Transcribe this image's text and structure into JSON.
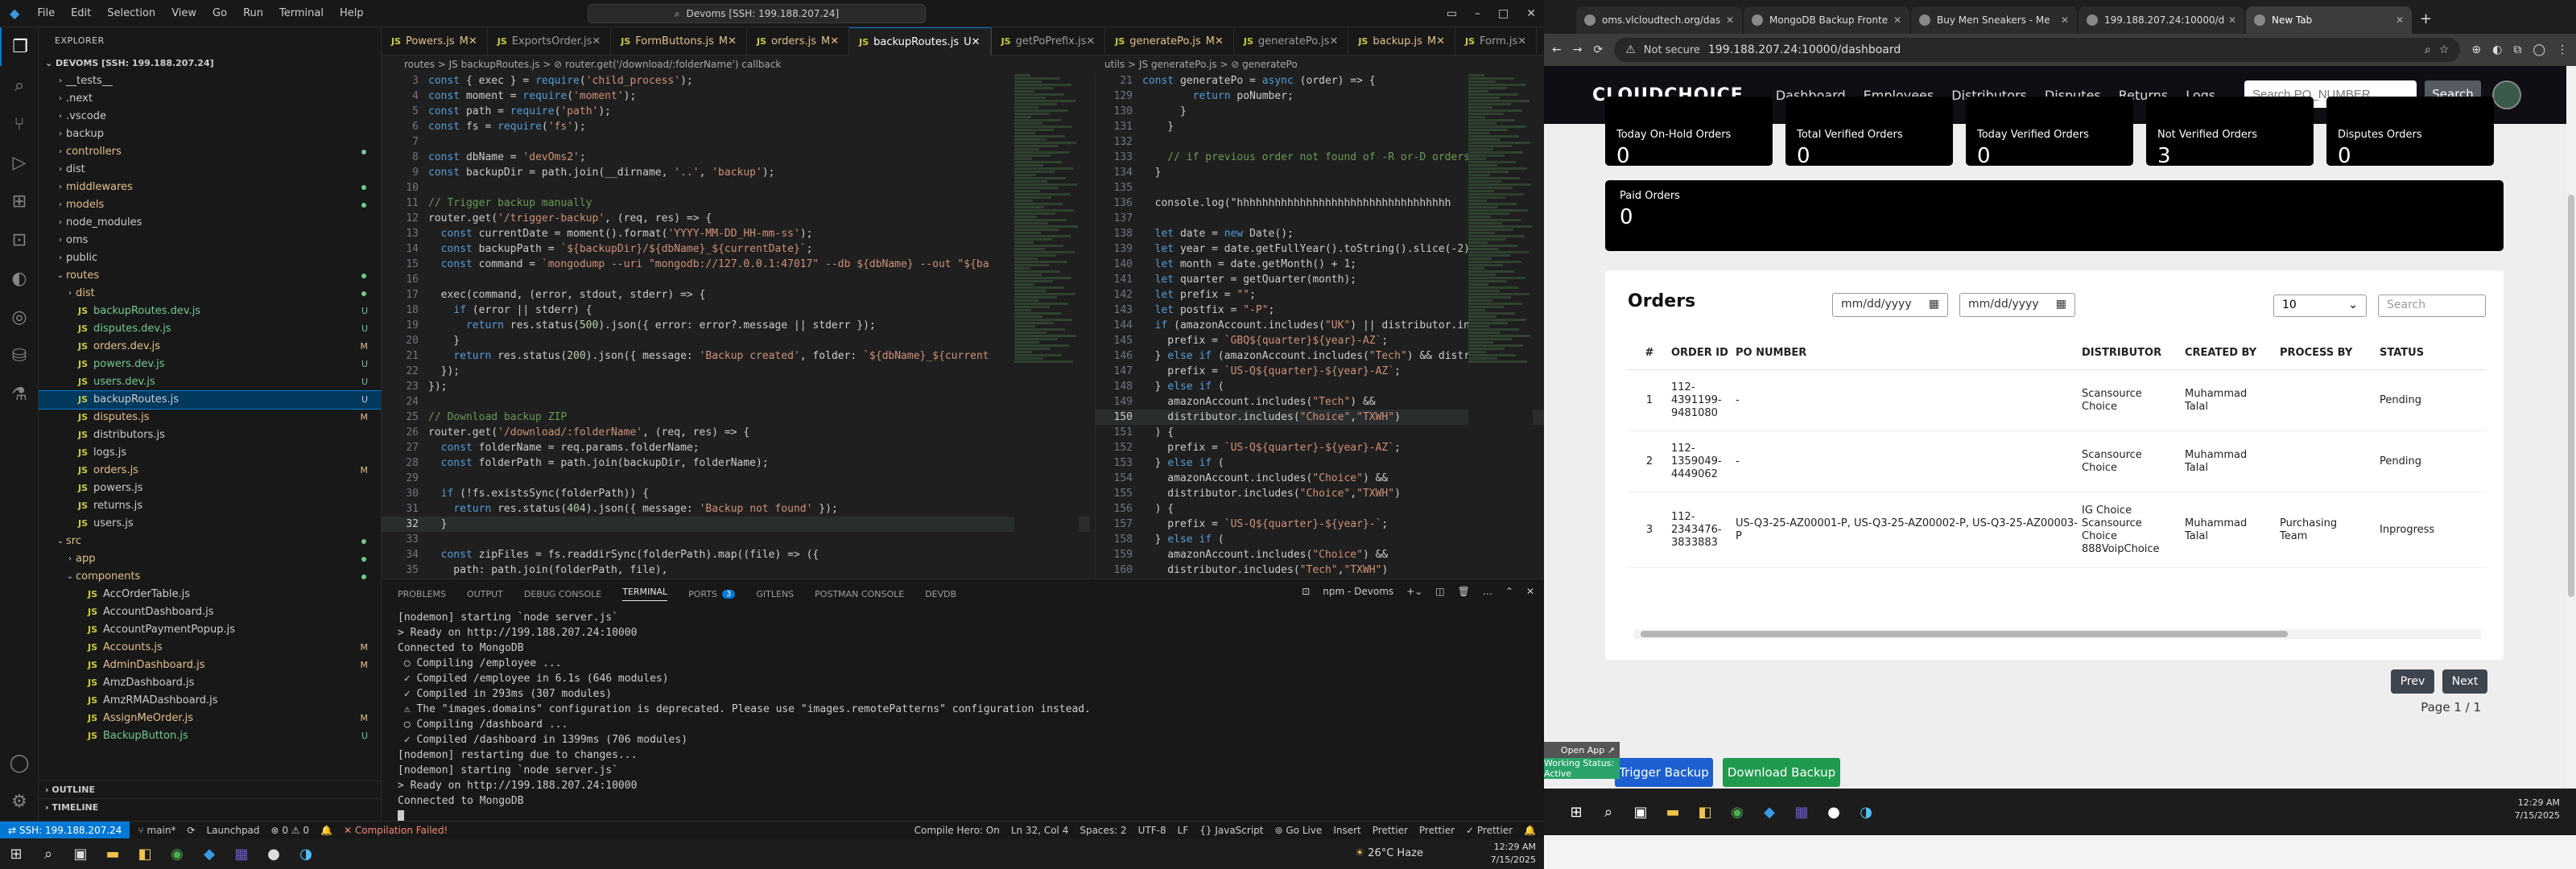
{
  "vscode": {
    "menu": [
      "File",
      "Edit",
      "Selection",
      "View",
      "Go",
      "Run",
      "Terminal",
      "Help"
    ],
    "command_center": "Devoms [SSH: 199.188.207.24]",
    "explorer_title": "EXPLORER",
    "root": "DEVOMS [SSH: 199.188.207.24]",
    "tree": [
      {
        "label": "__tests__",
        "kind": "folder",
        "indent": 1,
        "state": ""
      },
      {
        "label": ".next",
        "kind": "folder",
        "indent": 1,
        "state": ""
      },
      {
        "label": ".vscode",
        "kind": "folder",
        "indent": 1,
        "state": ""
      },
      {
        "label": "backup",
        "kind": "folder",
        "indent": 1,
        "state": ""
      },
      {
        "label": "controllers",
        "kind": "folder",
        "indent": 1,
        "state": "mod"
      },
      {
        "label": "dist",
        "kind": "folder",
        "indent": 1,
        "state": ""
      },
      {
        "label": "middlewares",
        "kind": "folder",
        "indent": 1,
        "state": "mod"
      },
      {
        "label": "models",
        "kind": "folder",
        "indent": 1,
        "state": "mod"
      },
      {
        "label": "node_modules",
        "kind": "folder",
        "indent": 1,
        "state": ""
      },
      {
        "label": "oms",
        "kind": "folder",
        "indent": 1,
        "state": ""
      },
      {
        "label": "public",
        "kind": "folder",
        "indent": 1,
        "state": ""
      },
      {
        "label": "routes",
        "kind": "folder-open",
        "indent": 1,
        "state": "mod"
      },
      {
        "label": "dist",
        "kind": "folder",
        "indent": 2,
        "state": "mod"
      },
      {
        "label": "backupRoutes.dev.js",
        "kind": "js",
        "indent": 2,
        "state": "unt",
        "badge": "U"
      },
      {
        "label": "disputes.dev.js",
        "kind": "js",
        "indent": 2,
        "state": "unt",
        "badge": "U"
      },
      {
        "label": "orders.dev.js",
        "kind": "js",
        "indent": 2,
        "state": "mod",
        "badge": "M"
      },
      {
        "label": "powers.dev.js",
        "kind": "js",
        "indent": 2,
        "state": "unt",
        "badge": "U"
      },
      {
        "label": "users.dev.js",
        "kind": "js",
        "indent": 2,
        "state": "unt",
        "badge": "U"
      },
      {
        "label": "backupRoutes.js",
        "kind": "js",
        "indent": 2,
        "state": "sel",
        "badge": "U"
      },
      {
        "label": "disputes.js",
        "kind": "js",
        "indent": 2,
        "state": "mod",
        "badge": "M"
      },
      {
        "label": "distributors.js",
        "kind": "js",
        "indent": 2,
        "state": "",
        "badge": ""
      },
      {
        "label": "logs.js",
        "kind": "js",
        "indent": 2,
        "state": "",
        "badge": ""
      },
      {
        "label": "orders.js",
        "kind": "js",
        "indent": 2,
        "state": "mod",
        "badge": "M"
      },
      {
        "label": "powers.js",
        "kind": "js",
        "indent": 2,
        "state": "",
        "badge": ""
      },
      {
        "label": "returns.js",
        "kind": "js",
        "indent": 2,
        "state": "",
        "badge": ""
      },
      {
        "label": "users.js",
        "kind": "js",
        "indent": 2,
        "state": "",
        "badge": ""
      },
      {
        "label": "src",
        "kind": "folder-open",
        "indent": 1,
        "state": "mod"
      },
      {
        "label": "app",
        "kind": "folder",
        "indent": 2,
        "state": "mod"
      },
      {
        "label": "components",
        "kind": "folder-open",
        "indent": 2,
        "state": "mod"
      },
      {
        "label": "AccOrderTable.js",
        "kind": "js",
        "indent": 3,
        "state": "",
        "badge": ""
      },
      {
        "label": "AccountDashboard.js",
        "kind": "js",
        "indent": 3,
        "state": "",
        "badge": ""
      },
      {
        "label": "AccountPaymentPopup.js",
        "kind": "js",
        "indent": 3,
        "state": "",
        "badge": ""
      },
      {
        "label": "Accounts.js",
        "kind": "js",
        "indent": 3,
        "state": "mod",
        "badge": "M"
      },
      {
        "label": "AdminDashboard.js",
        "kind": "js",
        "indent": 3,
        "state": "mod",
        "badge": "M"
      },
      {
        "label": "AmzDashboard.js",
        "kind": "js",
        "indent": 3,
        "state": "",
        "badge": ""
      },
      {
        "label": "AmzRMADashboard.js",
        "kind": "js",
        "indent": 3,
        "state": "",
        "badge": ""
      },
      {
        "label": "AssignMeOrder.js",
        "kind": "js",
        "indent": 3,
        "state": "mod",
        "badge": "M"
      },
      {
        "label": "BackupButton.js",
        "kind": "js",
        "indent": 3,
        "state": "unt",
        "badge": "U"
      }
    ],
    "outline": "OUTLINE",
    "timeline": "TIMELINE",
    "tabs": [
      {
        "label": "Powers.js",
        "state": "mod",
        "suffix": "M"
      },
      {
        "label": "ExportsOrder.js",
        "state": "",
        "suffix": ""
      },
      {
        "label": "FormButtons.js",
        "state": "mod",
        "suffix": "M"
      },
      {
        "label": "orders.js",
        "state": "mod",
        "suffix": "M"
      },
      {
        "label": "backupRoutes.js",
        "state": "active",
        "suffix": "U"
      },
      {
        "label": "getPoPrefix.js",
        "state": "",
        "suffix": ""
      },
      {
        "label": "generatePo.js",
        "state": "mod",
        "suffix": "M"
      },
      {
        "label": "generatePo.js",
        "state": "",
        "suffix": ""
      },
      {
        "label": "backup.js",
        "state": "mod",
        "suffix": "M"
      },
      {
        "label": "Form.js",
        "state": "",
        "suffix": ""
      }
    ],
    "breadcrumb_left": "routes > JS backupRoutes.js > ⊘ router.get('/download/:folderName') callback",
    "breadcrumb_right": "utils > JS generatePo.js > ⊘ generatePo",
    "code_left": [
      {
        "n": "3",
        "t": "const { exec } = require('child_process');"
      },
      {
        "n": "4",
        "t": "const moment = require('moment');"
      },
      {
        "n": "5",
        "t": "const path = require('path');"
      },
      {
        "n": "6",
        "t": "const fs = require('fs');"
      },
      {
        "n": "7",
        "t": ""
      },
      {
        "n": "8",
        "t": "const dbName = 'devOms2';"
      },
      {
        "n": "9",
        "t": "const backupDir = path.join(__dirname, '..', 'backup');"
      },
      {
        "n": "10",
        "t": ""
      },
      {
        "n": "11",
        "t": "// Trigger backup manually"
      },
      {
        "n": "12",
        "t": "router.get('/trigger-backup', (req, res) => {"
      },
      {
        "n": "13",
        "t": "  const currentDate = moment().format('YYYY-MM-DD_HH-mm-ss');"
      },
      {
        "n": "14",
        "t": "  const backupPath = `${backupDir}/${dbName}_${currentDate}`;"
      },
      {
        "n": "15",
        "t": "  const command = `mongodump --uri \"mongodb://127.0.0.1:47017\" --db ${dbName} --out \"${ba"
      },
      {
        "n": "16",
        "t": ""
      },
      {
        "n": "17",
        "t": "  exec(command, (error, stdout, stderr) => {"
      },
      {
        "n": "18",
        "t": "    if (error || stderr) {"
      },
      {
        "n": "19",
        "t": "      return res.status(500).json({ error: error?.message || stderr });"
      },
      {
        "n": "20",
        "t": "    }"
      },
      {
        "n": "21",
        "t": "    return res.status(200).json({ message: 'Backup created', folder: `${dbName}_${current"
      },
      {
        "n": "22",
        "t": "  });"
      },
      {
        "n": "23",
        "t": "});"
      },
      {
        "n": "24",
        "t": ""
      },
      {
        "n": "25",
        "t": "// Download backup ZIP"
      },
      {
        "n": "26",
        "t": "router.get('/download/:folderName', (req, res) => {"
      },
      {
        "n": "27",
        "t": "  const folderName = req.params.folderName;"
      },
      {
        "n": "28",
        "t": "  const folderPath = path.join(backupDir, folderName);"
      },
      {
        "n": "29",
        "t": ""
      },
      {
        "n": "30",
        "t": "  if (!fs.existsSync(folderPath)) {"
      },
      {
        "n": "31",
        "t": "    return res.status(404).json({ message: 'Backup not found' });"
      },
      {
        "n": "32",
        "t": "  }"
      },
      {
        "n": "33",
        "t": ""
      },
      {
        "n": "34",
        "t": "  const zipFiles = fs.readdirSync(folderPath).map((file) => ({"
      },
      {
        "n": "35",
        "t": "    path: path.join(folderPath, file),"
      }
    ],
    "code_right": [
      {
        "n": "21",
        "t": "const generatePo = async (order) => {"
      },
      {
        "n": "129",
        "t": "        return poNumber;"
      },
      {
        "n": "130",
        "t": "      }"
      },
      {
        "n": "131",
        "t": "    }"
      },
      {
        "n": "132",
        "t": ""
      },
      {
        "n": "133",
        "t": "    // if previous order not found of -R or-D orders t"
      },
      {
        "n": "134",
        "t": "  }"
      },
      {
        "n": "135",
        "t": ""
      },
      {
        "n": "136",
        "t": "  console.log(\"hhhhhhhhhhhhhhhhhhhhhhhhhhhhhhhhhh"
      },
      {
        "n": "137",
        "t": ""
      },
      {
        "n": "138",
        "t": "  let date = new Date();"
      },
      {
        "n": "139",
        "t": "  let year = date.getFullYear().toString().slice(-2);"
      },
      {
        "n": "140",
        "t": "  let month = date.getMonth() + 1;"
      },
      {
        "n": "141",
        "t": "  let quarter = getQuarter(month);"
      },
      {
        "n": "142",
        "t": "  let prefix = \"\";"
      },
      {
        "n": "143",
        "t": "  let postfix = \"-P\";"
      },
      {
        "n": "144",
        "t": "  if (amazonAccount.includes(\"UK\") || distributor.incl"
      },
      {
        "n": "145",
        "t": "    prefix = `GBQ${quarter}${year}-AZ`;"
      },
      {
        "n": "146",
        "t": "  } else if (amazonAccount.includes(\"Tech\") && distrib"
      },
      {
        "n": "147",
        "t": "    prefix = `US-Q${quarter}-${year}-AZ`;"
      },
      {
        "n": "148",
        "t": "  } else if ("
      },
      {
        "n": "149",
        "t": "    amazonAccount.includes(\"Tech\") &&"
      },
      {
        "n": "150",
        "t": "    distributor.includes(\"Choice\",\"TXWH\")"
      },
      {
        "n": "151",
        "t": "  ) {"
      },
      {
        "n": "152",
        "t": "    prefix = `US-Q${quarter}-${year}-AZ`;"
      },
      {
        "n": "153",
        "t": "  } else if ("
      },
      {
        "n": "154",
        "t": "    amazonAccount.includes(\"Choice\") &&"
      },
      {
        "n": "155",
        "t": "    distributor.includes(\"Choice\",\"TXWH\")"
      },
      {
        "n": "156",
        "t": "  ) {"
      },
      {
        "n": "157",
        "t": "    prefix = `US-Q${quarter}-${year}-`;"
      },
      {
        "n": "158",
        "t": "  } else if ("
      },
      {
        "n": "159",
        "t": "    amazonAccount.includes(\"Choice\") &&"
      },
      {
        "n": "160",
        "t": "    distributor.includes(\"Tech\",\"TXWH\")"
      }
    ],
    "panel_tabs": [
      "PROBLEMS",
      "OUTPUT",
      "DEBUG CONSOLE",
      "TERMINAL",
      "PORTS",
      "GITLENS",
      "POSTMAN CONSOLE",
      "DEVDB"
    ],
    "ports_count": "3",
    "terminal_name": "npm - Devoms",
    "terminal": [
      {
        "t": "[nodemon] starting `node server.js`",
        "c": "t-yellow"
      },
      {
        "t": "> Ready on http://199.188.207.24:10000",
        "c": ""
      },
      {
        "t": "Connected to MongoDB",
        "c": ""
      },
      {
        "t": " ○ Compiling /employee ...",
        "c": ""
      },
      {
        "t": " ✓ Compiled /employee in 6.1s (646 modules)",
        "c": "t-green"
      },
      {
        "t": " ✓ Compiled in 293ms (307 modules)",
        "c": "t-green"
      },
      {
        "t": " ⚠ The \"images.domains\" configuration is deprecated. Please use \"images.remotePatterns\" configuration instead.",
        "c": "t-yellow"
      },
      {
        "t": " ○ Compiling /dashboard ...",
        "c": ""
      },
      {
        "t": " ✓ Compiled /dashboard in 1399ms (706 modules)",
        "c": "t-green"
      },
      {
        "t": "[nodemon] restarting due to changes...",
        "c": "t-yellow"
      },
      {
        "t": "[nodemon] starting `node server.js`",
        "c": "t-yellow"
      },
      {
        "t": "> Ready on http://199.188.207.24:10000",
        "c": ""
      },
      {
        "t": "Connected to MongoDB",
        "c": ""
      }
    ],
    "status": {
      "remote": "SSH: 199.188.207.24",
      "branch": "main*",
      "sync": "⟳",
      "launchpad": "Launchpad",
      "problems": "⊗ 0 ⚠ 0",
      "compile": "✕ Compilation Failed!",
      "compile_hero": "Compile Hero: On",
      "position": "Ln 32, Col 4",
      "spaces": "Spaces: 2",
      "encoding": "UTF-8",
      "eol": "LF",
      "language": "{} JavaScript",
      "golive": "Go Live",
      "insert": "Insert",
      "prettier1": "Prettier",
      "prettier2": "Prettier",
      "prettier3": "✓ Prettier"
    },
    "weather": "26°C Haze",
    "time": "12:29 AM",
    "date": "7/15/2025"
  },
  "chrome": {
    "tabs": [
      {
        "label": "oms.vlcloudtech.org/das"
      },
      {
        "label": "MongoDB Backup Fronte"
      },
      {
        "label": "Buy Men Sneakers - Me"
      },
      {
        "label": "199.188.207.24:10000/d"
      },
      {
        "label": "New Tab",
        "active": true
      }
    ],
    "not_secure": "Not secure",
    "url": "199.188.207.24:10000/dashboard"
  },
  "app": {
    "logo": "CLOUDCHOICE",
    "nav": [
      "Dashboard",
      "Employees",
      "Distributors",
      "Disputes",
      "Returns",
      "Logs"
    ],
    "search_placeholder": "Search PO_NUMBER...",
    "search_button": "Search",
    "stats": [
      {
        "label": "Today On-Hold Orders",
        "value": "0"
      },
      {
        "label": "Total Verified Orders",
        "value": "0"
      },
      {
        "label": "Today Verified Orders",
        "value": "0"
      },
      {
        "label": "Not Verified Orders",
        "value": "3"
      },
      {
        "label": "Disputes Orders",
        "value": "0"
      }
    ],
    "paid": {
      "label": "Paid Orders",
      "value": "0"
    },
    "orders": {
      "title": "Orders",
      "date_from": "mm/dd/yyyy",
      "date_to": "mm/dd/yyyy",
      "page_size": "10",
      "search_placeholder": "Search",
      "columns": [
        "#",
        "ORDER ID",
        "PO NUMBER",
        "DISTRIBUTOR",
        "CREATED BY",
        "PROCESS BY",
        "STATUS"
      ],
      "rows": [
        {
          "n": "1",
          "order_id": "112-\n4391199-\n9481080",
          "po": "-",
          "distributor": "Scansource\nChoice",
          "created_by": "Muhammad\nTalal",
          "process_by": "",
          "status": "Pending"
        },
        {
          "n": "2",
          "order_id": "112-\n1359049-\n4449062",
          "po": "-",
          "distributor": "Scansource\nChoice",
          "created_by": "Muhammad\nTalal",
          "process_by": "",
          "status": "Pending"
        },
        {
          "n": "3",
          "order_id": "112-\n2343476-\n3833883",
          "po": "US-Q3-25-AZ00001-P, US-Q3-25-AZ00002-P, US-Q3-25-AZ00003-P",
          "distributor": "IG Choice\nScansource\nChoice\n888VoipChoice",
          "created_by": "Muhammad\nTalal",
          "process_by": "Purchasing\nTeam",
          "status": "Inprogress"
        }
      ],
      "prev": "Prev",
      "next": "Next",
      "page_info": "Page 1 / 1"
    },
    "trigger_backup": "Trigger Backup",
    "download_backup": "Download Backup",
    "open_app": "Open App ↗",
    "working_status": "Working Status: Active",
    "colors": {
      "trigger": "#1d5fd1",
      "download": "#1f9a4e",
      "navbar": "#0e0e14"
    }
  }
}
